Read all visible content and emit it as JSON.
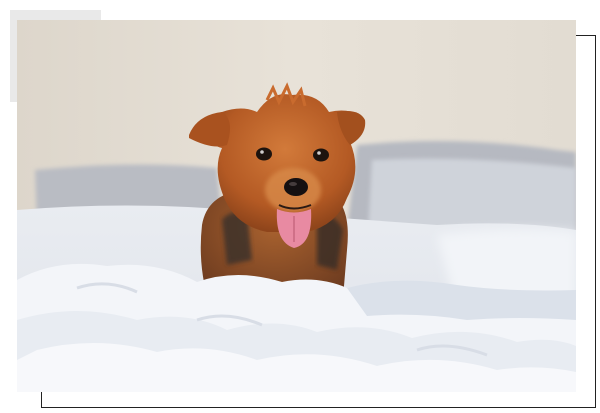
{
  "photo": {
    "subject": "small-dog-on-bed",
    "colors": {
      "wall": "#e6e0d6",
      "pillow": "#b9bcc2",
      "bedding": "#eef1f6",
      "blanket": "#f3f5f9",
      "fur": "#c0662c",
      "fur_dark": "#4a3a30",
      "tongue": "#e88aa2"
    }
  },
  "frame": {
    "outline_color": "#222222",
    "accent_color": "#e9e9e9"
  }
}
